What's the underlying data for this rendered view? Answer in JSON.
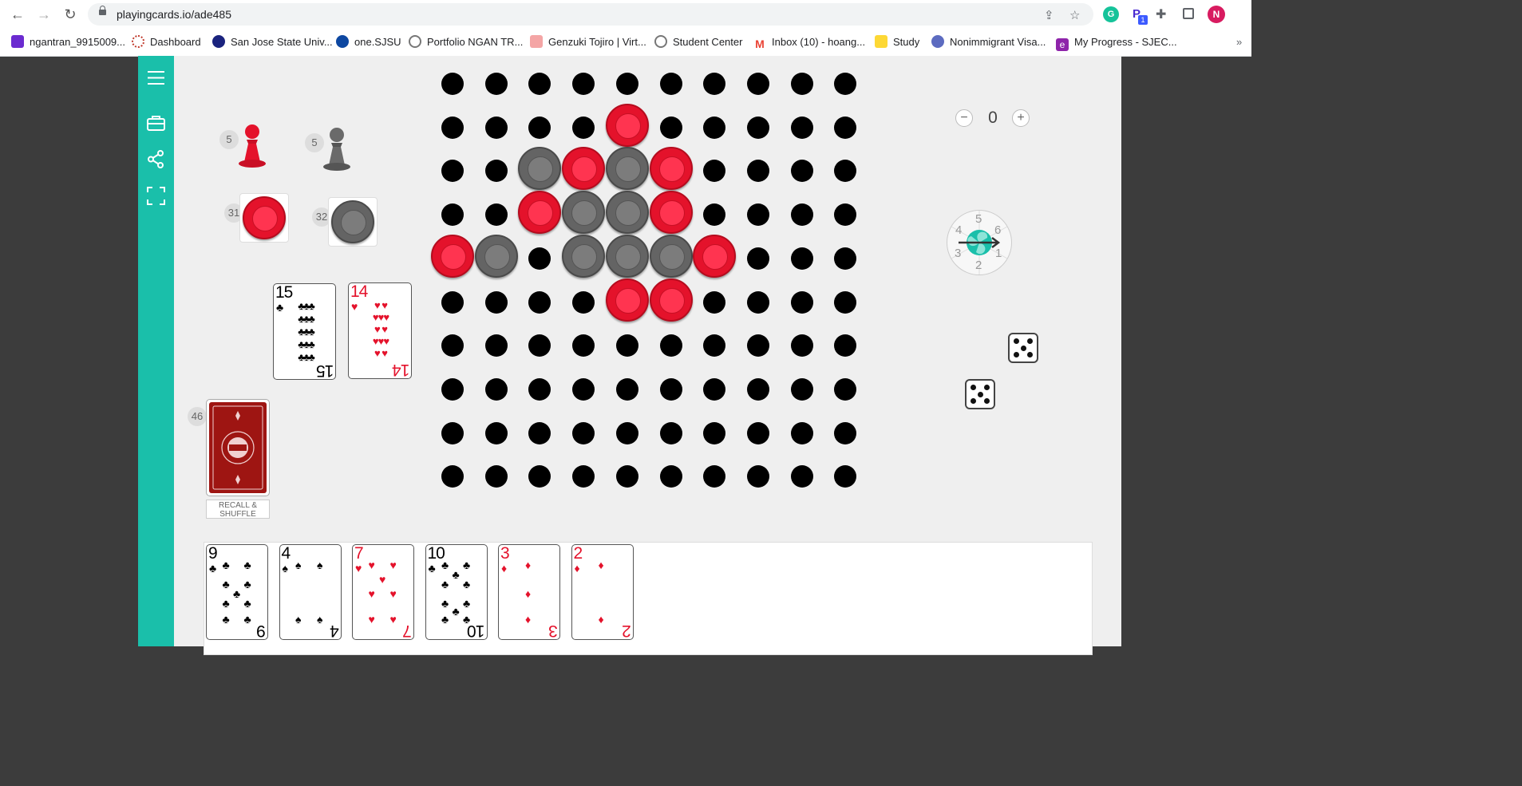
{
  "browser": {
    "url": "playingcards.io/ade485",
    "profile_initial": "N",
    "ext_badge": "1",
    "bookmarks": [
      {
        "label": "ngantran_9915009...",
        "color": "#6b2bd0"
      },
      {
        "label": "Dashboard",
        "color": "#c0392b"
      },
      {
        "label": "San Jose State Univ...",
        "color": "#1a237e"
      },
      {
        "label": "one.SJSU",
        "color": "#0d47a1"
      },
      {
        "label": "Portfolio NGAN TR...",
        "color": "#777777"
      },
      {
        "label": "Genzuki Tojiro | Virt...",
        "color": "#e57373"
      },
      {
        "label": "Student Center",
        "color": "#777777"
      },
      {
        "label": "Inbox (10) - hoang...",
        "color": "#ea4335"
      },
      {
        "label": "Study",
        "color": "#fdd835"
      },
      {
        "label": "Nonimmigrant Visa...",
        "color": "#5c6bc0"
      },
      {
        "label": "My Progress - SJEC...",
        "color": "#8e24aa"
      }
    ]
  },
  "colors": {
    "teal": "#1abfaa",
    "red": "#e4122b",
    "gray": "#646464"
  },
  "pieces": {
    "red_pawn_count": "5",
    "gray_pawn_count": "5",
    "red_checker_count": "31",
    "gray_checker_count": "32"
  },
  "piles": {
    "clubs_card": {
      "rank": "15",
      "suit": "♣"
    },
    "hearts_card": {
      "rank": "14",
      "suit": "♥"
    },
    "deck_count": "46",
    "recall_label": "RECALL & SHUFFLE"
  },
  "counter": {
    "minus": "−",
    "value": "0",
    "plus": "+"
  },
  "spinner": {
    "numbers": [
      "5",
      "6",
      "1",
      "2",
      "3",
      "4"
    ]
  },
  "dice": [
    {
      "value": 5
    },
    {
      "value": 5
    }
  ],
  "hand": [
    {
      "rank": "9",
      "suit": "♣",
      "color": "black"
    },
    {
      "rank": "4",
      "suit": "♠",
      "color": "black"
    },
    {
      "rank": "7",
      "suit": "♥",
      "color": "red"
    },
    {
      "rank": "10",
      "suit": "♣",
      "color": "black"
    },
    {
      "rank": "3",
      "suit": "♦",
      "color": "red"
    },
    {
      "rank": "2",
      "suit": "♦",
      "color": "red"
    }
  ],
  "board": {
    "cols": 10,
    "rows": 10,
    "checkers": [
      {
        "col": 4,
        "row": 1,
        "color": "red"
      },
      {
        "col": 2,
        "row": 2,
        "color": "gray"
      },
      {
        "col": 3,
        "row": 2,
        "color": "red"
      },
      {
        "col": 4,
        "row": 2,
        "color": "gray"
      },
      {
        "col": 5,
        "row": 2,
        "color": "red"
      },
      {
        "col": 2,
        "row": 3,
        "color": "red"
      },
      {
        "col": 3,
        "row": 3,
        "color": "gray"
      },
      {
        "col": 4,
        "row": 3,
        "color": "gray"
      },
      {
        "col": 5,
        "row": 3,
        "color": "red"
      },
      {
        "col": 0,
        "row": 4,
        "color": "red"
      },
      {
        "col": 1,
        "row": 4,
        "color": "gray"
      },
      {
        "col": 3,
        "row": 4,
        "color": "gray"
      },
      {
        "col": 4,
        "row": 4,
        "color": "gray"
      },
      {
        "col": 5,
        "row": 4,
        "color": "gray"
      },
      {
        "col": 6,
        "row": 4,
        "color": "red"
      },
      {
        "col": 4,
        "row": 5,
        "color": "red"
      },
      {
        "col": 5,
        "row": 5,
        "color": "red"
      }
    ]
  }
}
